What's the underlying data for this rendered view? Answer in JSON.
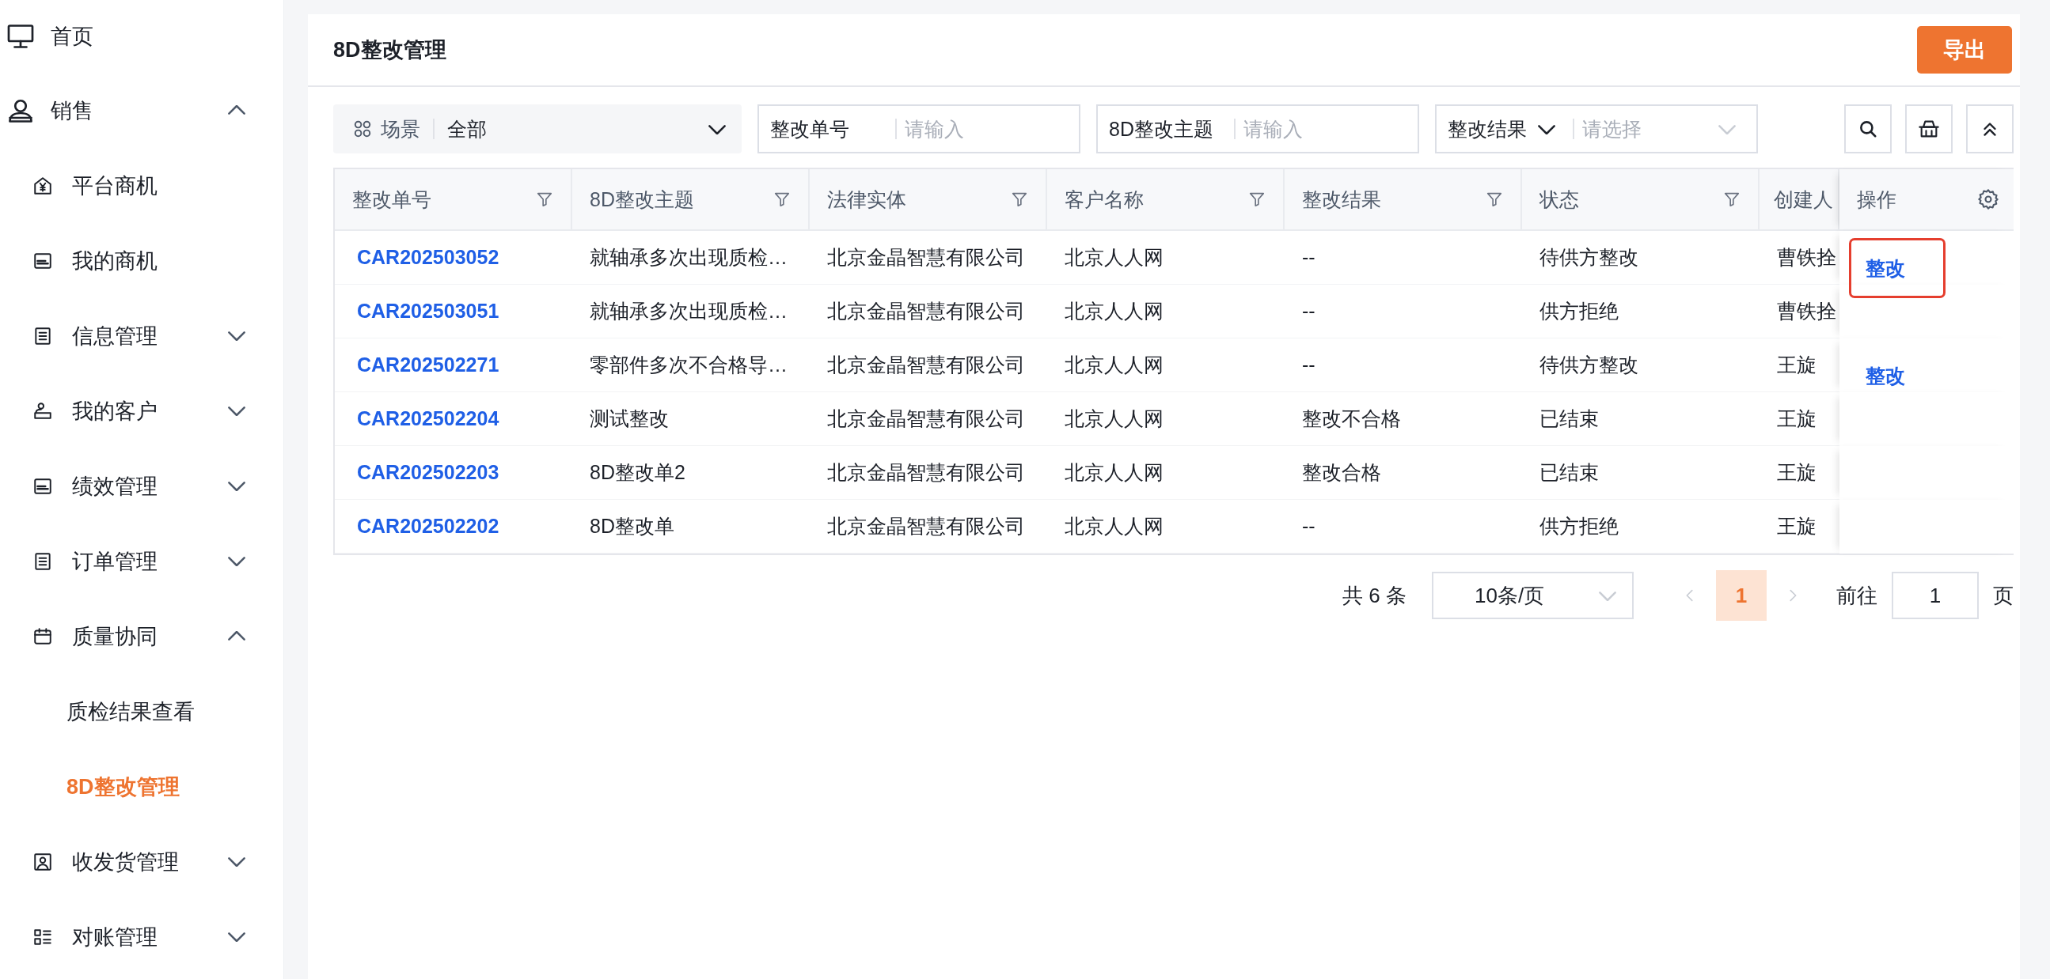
{
  "sidebar": {
    "items": [
      {
        "label": "首页",
        "selected": false
      },
      {
        "label": "销售",
        "selected": false,
        "expanded": true,
        "children": [
          {
            "label": "平台商机",
            "selected": false
          },
          {
            "label": "我的商机",
            "selected": false
          },
          {
            "label": "信息管理",
            "selected": false,
            "expanded": false
          },
          {
            "label": "我的客户",
            "selected": false,
            "expanded": false
          },
          {
            "label": "绩效管理",
            "selected": false,
            "expanded": false
          },
          {
            "label": "订单管理",
            "selected": false,
            "expanded": false
          },
          {
            "label": "质量协同",
            "selected": false,
            "expanded": true,
            "children": [
              {
                "label": "质检结果查看",
                "selected": false
              },
              {
                "label": "8D整改管理",
                "selected": true
              }
            ]
          },
          {
            "label": "收发货管理",
            "selected": false,
            "expanded": false
          },
          {
            "label": "对账管理",
            "selected": false,
            "expanded": false
          }
        ]
      }
    ]
  },
  "page": {
    "title": "8D整改管理",
    "export_button": "导出"
  },
  "filters": {
    "scene": {
      "label": "场景",
      "value": "全部"
    },
    "fields": [
      {
        "kind": "input",
        "label": "整改单号",
        "placeholder": "请输入"
      },
      {
        "kind": "input",
        "label": "8D整改主题",
        "placeholder": "请输入"
      },
      {
        "kind": "select",
        "label": "整改结果",
        "placeholder": "请选择"
      }
    ]
  },
  "table": {
    "columns": [
      {
        "label": "整改单号",
        "filter": true
      },
      {
        "label": "8D整改主题",
        "filter": true
      },
      {
        "label": "法律实体",
        "filter": true
      },
      {
        "label": "客户名称",
        "filter": true
      },
      {
        "label": "整改结果",
        "filter": true
      },
      {
        "label": "状态",
        "filter": true
      },
      {
        "label": "创建人",
        "filter": false
      }
    ],
    "action_column": "操作",
    "rows": [
      {
        "cells": [
          "CAR202503052",
          "就轴承多次出现质检…",
          "北京金晶智慧有限公司",
          "北京人人网",
          "--",
          "待供方整改",
          "曹铁拴"
        ],
        "action": {
          "label": "整改",
          "highlighted": true
        }
      },
      {
        "cells": [
          "CAR202503051",
          "就轴承多次出现质检…",
          "北京金晶智慧有限公司",
          "北京人人网",
          "--",
          "供方拒绝",
          "曹铁拴"
        ]
      },
      {
        "cells": [
          "CAR202502271",
          "零部件多次不合格导…",
          "北京金晶智慧有限公司",
          "北京人人网",
          "--",
          "待供方整改",
          "王旋"
        ],
        "action": {
          "label": "整改",
          "highlighted": false
        }
      },
      {
        "cells": [
          "CAR202502204",
          "测试整改",
          "北京金晶智慧有限公司",
          "北京人人网",
          "整改不合格",
          "已结束",
          "王旋"
        ]
      },
      {
        "cells": [
          "CAR202502203",
          "8D整改单2",
          "北京金晶智慧有限公司",
          "北京人人网",
          "整改合格",
          "已结束",
          "王旋"
        ]
      },
      {
        "cells": [
          "CAR202502202",
          "8D整改单",
          "北京金晶智慧有限公司",
          "北京人人网",
          "--",
          "供方拒绝",
          "王旋"
        ]
      }
    ]
  },
  "pagination": {
    "total": "共 6 条",
    "page_size": "10条/页",
    "pages": [
      {
        "label": "1",
        "selected": true
      }
    ],
    "goto_label": "前往",
    "goto_value": "1",
    "page_suffix": "页"
  }
}
